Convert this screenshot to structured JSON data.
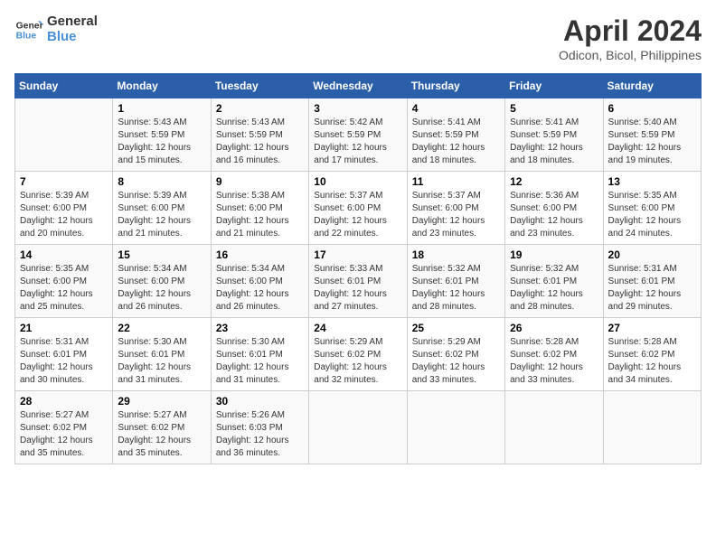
{
  "header": {
    "logo_line1": "General",
    "logo_line2": "Blue",
    "month": "April 2024",
    "location": "Odicon, Bicol, Philippines"
  },
  "days_of_week": [
    "Sunday",
    "Monday",
    "Tuesday",
    "Wednesday",
    "Thursday",
    "Friday",
    "Saturday"
  ],
  "weeks": [
    [
      {
        "num": "",
        "detail": ""
      },
      {
        "num": "1",
        "detail": "Sunrise: 5:43 AM\nSunset: 5:59 PM\nDaylight: 12 hours\nand 15 minutes."
      },
      {
        "num": "2",
        "detail": "Sunrise: 5:43 AM\nSunset: 5:59 PM\nDaylight: 12 hours\nand 16 minutes."
      },
      {
        "num": "3",
        "detail": "Sunrise: 5:42 AM\nSunset: 5:59 PM\nDaylight: 12 hours\nand 17 minutes."
      },
      {
        "num": "4",
        "detail": "Sunrise: 5:41 AM\nSunset: 5:59 PM\nDaylight: 12 hours\nand 18 minutes."
      },
      {
        "num": "5",
        "detail": "Sunrise: 5:41 AM\nSunset: 5:59 PM\nDaylight: 12 hours\nand 18 minutes."
      },
      {
        "num": "6",
        "detail": "Sunrise: 5:40 AM\nSunset: 5:59 PM\nDaylight: 12 hours\nand 19 minutes."
      }
    ],
    [
      {
        "num": "7",
        "detail": "Sunrise: 5:39 AM\nSunset: 6:00 PM\nDaylight: 12 hours\nand 20 minutes."
      },
      {
        "num": "8",
        "detail": "Sunrise: 5:39 AM\nSunset: 6:00 PM\nDaylight: 12 hours\nand 21 minutes."
      },
      {
        "num": "9",
        "detail": "Sunrise: 5:38 AM\nSunset: 6:00 PM\nDaylight: 12 hours\nand 21 minutes."
      },
      {
        "num": "10",
        "detail": "Sunrise: 5:37 AM\nSunset: 6:00 PM\nDaylight: 12 hours\nand 22 minutes."
      },
      {
        "num": "11",
        "detail": "Sunrise: 5:37 AM\nSunset: 6:00 PM\nDaylight: 12 hours\nand 23 minutes."
      },
      {
        "num": "12",
        "detail": "Sunrise: 5:36 AM\nSunset: 6:00 PM\nDaylight: 12 hours\nand 23 minutes."
      },
      {
        "num": "13",
        "detail": "Sunrise: 5:35 AM\nSunset: 6:00 PM\nDaylight: 12 hours\nand 24 minutes."
      }
    ],
    [
      {
        "num": "14",
        "detail": "Sunrise: 5:35 AM\nSunset: 6:00 PM\nDaylight: 12 hours\nand 25 minutes."
      },
      {
        "num": "15",
        "detail": "Sunrise: 5:34 AM\nSunset: 6:00 PM\nDaylight: 12 hours\nand 26 minutes."
      },
      {
        "num": "16",
        "detail": "Sunrise: 5:34 AM\nSunset: 6:00 PM\nDaylight: 12 hours\nand 26 minutes."
      },
      {
        "num": "17",
        "detail": "Sunrise: 5:33 AM\nSunset: 6:01 PM\nDaylight: 12 hours\nand 27 minutes."
      },
      {
        "num": "18",
        "detail": "Sunrise: 5:32 AM\nSunset: 6:01 PM\nDaylight: 12 hours\nand 28 minutes."
      },
      {
        "num": "19",
        "detail": "Sunrise: 5:32 AM\nSunset: 6:01 PM\nDaylight: 12 hours\nand 28 minutes."
      },
      {
        "num": "20",
        "detail": "Sunrise: 5:31 AM\nSunset: 6:01 PM\nDaylight: 12 hours\nand 29 minutes."
      }
    ],
    [
      {
        "num": "21",
        "detail": "Sunrise: 5:31 AM\nSunset: 6:01 PM\nDaylight: 12 hours\nand 30 minutes."
      },
      {
        "num": "22",
        "detail": "Sunrise: 5:30 AM\nSunset: 6:01 PM\nDaylight: 12 hours\nand 31 minutes."
      },
      {
        "num": "23",
        "detail": "Sunrise: 5:30 AM\nSunset: 6:01 PM\nDaylight: 12 hours\nand 31 minutes."
      },
      {
        "num": "24",
        "detail": "Sunrise: 5:29 AM\nSunset: 6:02 PM\nDaylight: 12 hours\nand 32 minutes."
      },
      {
        "num": "25",
        "detail": "Sunrise: 5:29 AM\nSunset: 6:02 PM\nDaylight: 12 hours\nand 33 minutes."
      },
      {
        "num": "26",
        "detail": "Sunrise: 5:28 AM\nSunset: 6:02 PM\nDaylight: 12 hours\nand 33 minutes."
      },
      {
        "num": "27",
        "detail": "Sunrise: 5:28 AM\nSunset: 6:02 PM\nDaylight: 12 hours\nand 34 minutes."
      }
    ],
    [
      {
        "num": "28",
        "detail": "Sunrise: 5:27 AM\nSunset: 6:02 PM\nDaylight: 12 hours\nand 35 minutes."
      },
      {
        "num": "29",
        "detail": "Sunrise: 5:27 AM\nSunset: 6:02 PM\nDaylight: 12 hours\nand 35 minutes."
      },
      {
        "num": "30",
        "detail": "Sunrise: 5:26 AM\nSunset: 6:03 PM\nDaylight: 12 hours\nand 36 minutes."
      },
      {
        "num": "",
        "detail": ""
      },
      {
        "num": "",
        "detail": ""
      },
      {
        "num": "",
        "detail": ""
      },
      {
        "num": "",
        "detail": ""
      }
    ]
  ]
}
